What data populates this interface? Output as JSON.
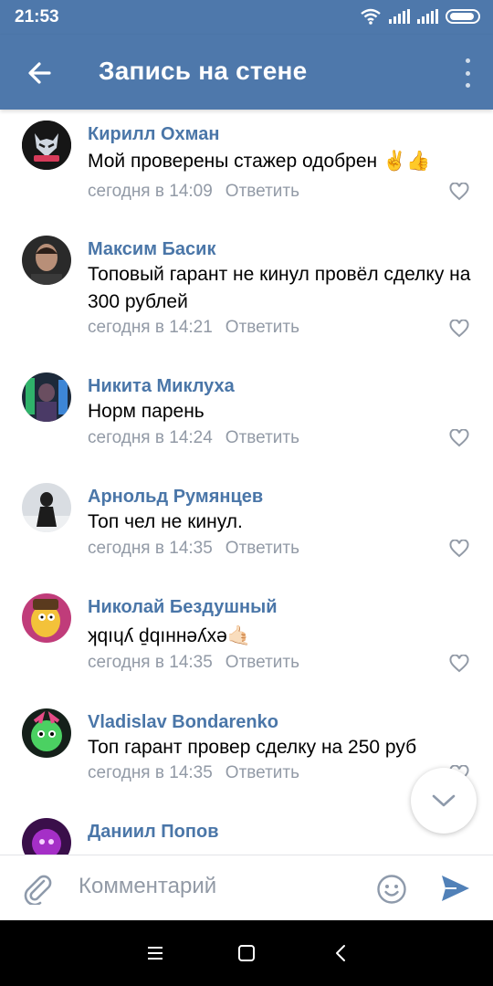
{
  "status": {
    "time": "21:53"
  },
  "header": {
    "title": "Запись на стене"
  },
  "comments": [
    {
      "author": "Кирилл Охман",
      "text": "Мой проверены стажер одобрен ✌️👍",
      "time": "сегодня в 14:09",
      "reply": "Ответить"
    },
    {
      "author": "Максим Басик",
      "text": "Топовый гарант не кинул провёл сделку на 300 рублей",
      "time": "сегодня в 14:21",
      "reply": "Ответить"
    },
    {
      "author": "Никита Миклуха",
      "text": "Норм парень",
      "time": "сегодня в 14:24",
      "reply": "Ответить"
    },
    {
      "author": "Арнольд Румянцев",
      "text": "Топ чел не кинул.",
      "time": "сегодня в 14:35",
      "reply": "Ответить"
    },
    {
      "author": "Николай Бездушный",
      "text": "ʞqıɥʎ ḏqıннǝʎхǝ🤙🏻",
      "time": "сегодня в 14:35",
      "reply": "Ответить"
    },
    {
      "author": "Vladislav Bondarenko",
      "text": "Топ гарант провер сделку на 250 руб",
      "time": "сегодня в 14:35",
      "reply": "Ответить"
    },
    {
      "author": "Даниил Попов",
      "text": "",
      "time": "",
      "reply": ""
    }
  ],
  "composer": {
    "placeholder": "Комментарий"
  },
  "colors": {
    "accent": "#4e78ab",
    "link": "#4a76a8",
    "meta": "#929aa6"
  }
}
